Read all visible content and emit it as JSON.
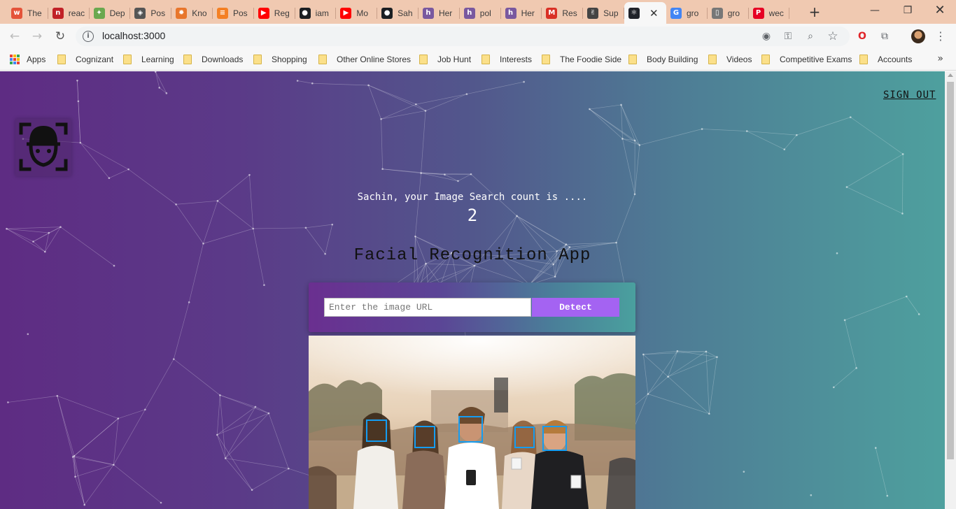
{
  "browser": {
    "tabs": [
      {
        "title": "The",
        "icon": "w-logo-icon",
        "color": "#e4533a"
      },
      {
        "title": "reac",
        "icon": "npm-icon",
        "color": "#c12127"
      },
      {
        "title": "Dep",
        "icon": "puzzle-icon",
        "color": "#6aa84f"
      },
      {
        "title": "Pos",
        "icon": "diamond-icon",
        "color": "#555555"
      },
      {
        "title": "Kno",
        "icon": "gear-flower-icon",
        "color": "#e8762c"
      },
      {
        "title": "Pos",
        "icon": "stackoverflow-icon",
        "color": "#f48024"
      },
      {
        "title": "Reg",
        "icon": "youtube-icon",
        "color": "#ff0000"
      },
      {
        "title": "iam",
        "icon": "github-icon",
        "color": "#1b1f23"
      },
      {
        "title": "Mo",
        "icon": "youtube-icon",
        "color": "#ff0000"
      },
      {
        "title": "Sah",
        "icon": "github-icon",
        "color": "#1b1f23"
      },
      {
        "title": "Her",
        "icon": "heroku-icon",
        "color": "#79589f"
      },
      {
        "title": "pol",
        "icon": "heroku-icon",
        "color": "#79589f"
      },
      {
        "title": "Her",
        "icon": "heroku-icon",
        "color": "#79589f"
      },
      {
        "title": "Res",
        "icon": "gmail-icon",
        "color": "#d93025"
      },
      {
        "title": "Sup",
        "icon": "hand-icon",
        "color": "#444444"
      },
      {
        "title": "",
        "icon": "react-icon",
        "color": "#20232a",
        "active": true
      },
      {
        "title": "gro",
        "icon": "google-icon",
        "color": "#4285f4"
      },
      {
        "title": "gro",
        "icon": "document-icon",
        "color": "#777777"
      },
      {
        "title": "wec",
        "icon": "pinterest-icon",
        "color": "#e60023"
      }
    ],
    "url": "localhost:3000",
    "bookmarks": [
      {
        "label": "Apps",
        "type": "apps"
      },
      {
        "label": "Cognizant",
        "type": "folder"
      },
      {
        "label": "Learning",
        "type": "folder"
      },
      {
        "label": "Downloads",
        "type": "folder"
      },
      {
        "label": "Shopping",
        "type": "folder"
      },
      {
        "label": "Other Online Stores",
        "type": "folder"
      },
      {
        "label": "Job Hunt",
        "type": "folder"
      },
      {
        "label": "Interests",
        "type": "folder"
      },
      {
        "label": "The Foodie Side",
        "type": "folder"
      },
      {
        "label": "Body Building",
        "type": "folder"
      },
      {
        "label": "Videos",
        "type": "folder"
      },
      {
        "label": "Competitive Exams",
        "type": "folder"
      },
      {
        "label": "Accounts",
        "type": "folder"
      }
    ]
  },
  "nav": {
    "sign_out": "SIGN OUT"
  },
  "rank": {
    "message": "Sachin, your Image Search count is ....",
    "count": "2"
  },
  "app": {
    "title": "Facial Recognition App",
    "input_placeholder": "Enter the image URL",
    "detect_label": "Detect"
  },
  "detected_faces": 5,
  "colors": {
    "accent": "#a463f2",
    "face_box": "#149df2",
    "gradient_start": "#5e2c83",
    "gradient_end": "#4ea09e"
  }
}
